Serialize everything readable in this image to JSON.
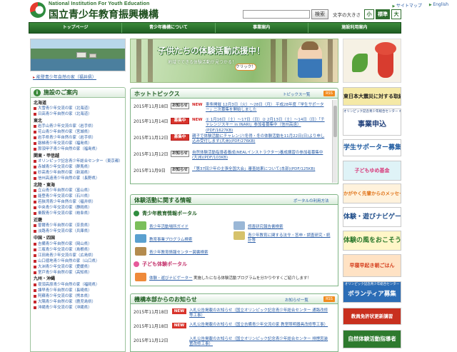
{
  "header": {
    "logo_en": "National Institution For Youth Education",
    "logo_ja": "国立青少年教育振興機構",
    "links": [
      "サイトマップ",
      "English"
    ],
    "search_button": "検索",
    "font_size_label": "文字の大きさ",
    "font_sizes": [
      "小",
      "標準",
      "大"
    ]
  },
  "gnav": [
    "トップページ",
    "青少年機構について",
    "事業案内",
    "施設利用案内"
  ],
  "photo_caption": "能登青少年自然の家（福井県）",
  "facilities": {
    "title": "施設のご案内",
    "regions": [
      {
        "name": "北海道",
        "items": [
          "大雪青少年交流の家（北海道）",
          "日高青少年自然の家（北海道）"
        ]
      },
      {
        "name": "東北",
        "items": [
          "岩手山青少年交流の家（岩手県）",
          "花山青少年自然の家（宮城県）",
          "岩手県青少年自然の家（岩手県）",
          "磐梯青少年交流の家（福島県）",
          "那須甲子青少年自然の家（福島県）"
        ]
      },
      {
        "name": "関東・甲信越",
        "items": [
          "オリンピック記念青少年総合センター（東京都）",
          "赤城青少年交流の家（群馬県）",
          "妙高青少年自然の家（新潟県）",
          "信州高遠青少年自然の家（長野県）"
        ]
      },
      {
        "name": "北陸・東海",
        "items": [
          "立山青少年自然の家（富山県）",
          "能登青少年交流の家（石川県）",
          "若狭湾青少年自然の家（福井県）",
          "中央青少年交流の家（静岡県）",
          "乗鞍青少年交流の家（岐阜県）"
        ]
      },
      {
        "name": "近畿",
        "items": [
          "曽爾青少年自然の家（奈良県）",
          "淡路青少年交流の家（兵庫県）"
        ]
      },
      {
        "name": "中国・四国",
        "items": [
          "吉備青少年自然の家（岡山県）",
          "三瓶青少年交流の家（島根県）",
          "江田島青少年交流の家（広島県）",
          "山口徳地青少年自然の家（山口県）",
          "大洲青少年交流の家（愛媛県）",
          "室戸青少年自然の家（高知県）"
        ]
      },
      {
        "name": "九州・沖縄",
        "items": [
          "夜須高原青少年自然の家（福岡県）",
          "諫早青少年自然の家（長崎県）",
          "阿蘇青少年交流の家（熊本県）",
          "大隅青少年自然の家（鹿児島県）",
          "沖縄青少年交流の家（沖縄県）"
        ]
      }
    ]
  },
  "banner": {
    "title": "子供たちの体験活動応援中！",
    "sub": "地域でできる体験活動が見つかる！",
    "click": "クリック！"
  },
  "hot_topics": {
    "title": "ホットトピックス",
    "list_link": "トピックス一覧",
    "rss": "RSS",
    "items": [
      {
        "date": "2015年11月18日",
        "badge": "お知らせ",
        "badge_type": "info",
        "new": "NEW",
        "text": "東条開催 12月3日（火）〜28日（月） 平成28年度「学生サポーター」二次募集を開始しました"
      },
      {
        "date": "2015年11月14日",
        "badge": "募集中",
        "badge_type": "recruit",
        "new": "NEW",
        "text": "① 1月16日（土）〜17日（日）② 2月13日（土）〜14日（日）「チャレンジスキー in INARI」参加者募集中（信州高遠）(PDF/1627KB)"
      },
      {
        "date": "2015年11月12日",
        "badge": "募集中",
        "badge_type": "recruit",
        "new": "",
        "text": "親子で体験活動にチャレンジ!冬得・冬の体験活動を11月22日(日)より申し込み受付します(大洲)(PDF/276KB)"
      },
      {
        "date": "2015年11月12日",
        "badge": "お知らせ",
        "badge_type": "info",
        "new": "",
        "text": "自然体験活動指導者養成(NEALインストラクター)養成講習の参加者募集中(大洲)(PDF/103KB)"
      },
      {
        "date": "2015年11月9日",
        "badge": "お知らせ",
        "badge_type": "info",
        "new": "",
        "text": "「第37回少年の主張全国大会」審査結果について(本部)(PDF/125KB)"
      }
    ]
  },
  "experience": {
    "title": "体験活動に関する情報",
    "link": "ポータルの利用方法",
    "portal1": "青少年教育情報ポータル",
    "portal1_links": [
      "青少年活動場所ガイド",
      "調査研究報告書検索",
      "教育事業プログラム検索",
      "青少年教育に関する法令・答申・調査研究・統計等",
      "青少年教育情報センター図書検索"
    ],
    "portal2": "子ども体験ポータル",
    "portal2_link": "体験・遊びナビゲーター",
    "portal2_desc": "実施したになる体験活動プログラムを分かりやすくご紹介します！"
  },
  "notices": {
    "title": "機構本部からのお知らせ",
    "list_link": "お知らせ一覧",
    "rss": "RSS",
    "items": [
      {
        "date": "2015年11月18日",
        "new": "NEW",
        "text": "入札公告掲載のお知らせ（国立オリンピック記念青少年総合センター 通路改修等工事）"
      },
      {
        "date": "2015年11月18日",
        "new": "NEW",
        "text": "入札公告掲載のお知らせ（国立吉備青少年交流の家 教室照明器具改修等工事）"
      },
      {
        "date": "2015年11月12日",
        "new": "",
        "text": "入札公告掲載のお知らせ（国立オリンピック記念青少年総合センター 排煙窓装置改修工事）"
      }
    ]
  },
  "right_banners": [
    {
      "text": "東日本大震災に対する取組",
      "bg": "#f5e9a6",
      "color": "#222"
    },
    {
      "sub": "オリンピック記念青少年総合センター 本部",
      "text": "事業申込",
      "bg": "#ffffff",
      "color": "#1e3e7a"
    },
    {
      "text": "学生サポーター募集",
      "bg": "#ffffff",
      "color": "#1e5aa0"
    },
    {
      "text": "子どもゆめ基金",
      "bg": "#dff3f7",
      "color": "#d83c7c"
    },
    {
      "text": "かがやく先輩からのメッセージ",
      "bg": "#fff2dc",
      "color": "#e0741a"
    },
    {
      "text": "体験・遊びナビゲーター",
      "bg": "#ffffff",
      "color": "#1f4d8a"
    },
    {
      "text": "体験の風をおこそう",
      "bg": "#fff6c8",
      "color": "#2e7a2e"
    },
    {
      "text": "早寝早起き朝ごはん",
      "bg": "#ffe2c4",
      "color": "#d5401f"
    },
    {
      "sub": "オリンピック記念青少年総合センター",
      "text": "ボランティア募集",
      "bg": "#2c6db6",
      "color": "#ffffff"
    },
    {
      "text": "教員免許状更新講習",
      "bg": "#c8301f",
      "color": "#ffffff"
    },
    {
      "text": "自然体験活動指導者",
      "bg": "#2e7a2e",
      "color": "#ffffff"
    }
  ]
}
